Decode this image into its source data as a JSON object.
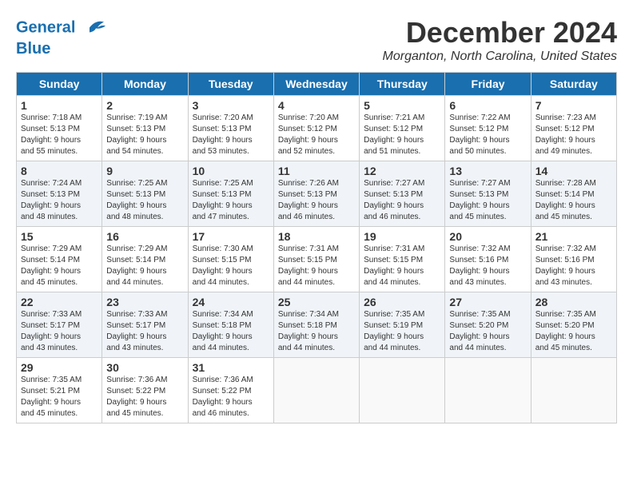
{
  "header": {
    "logo_line1": "General",
    "logo_line2": "Blue",
    "month": "December 2024",
    "location": "Morganton, North Carolina, United States"
  },
  "days_of_week": [
    "Sunday",
    "Monday",
    "Tuesday",
    "Wednesday",
    "Thursday",
    "Friday",
    "Saturday"
  ],
  "weeks": [
    [
      {
        "day": "1",
        "sunrise": "Sunrise: 7:18 AM",
        "sunset": "Sunset: 5:13 PM",
        "daylight": "Daylight: 9 hours and 55 minutes."
      },
      {
        "day": "2",
        "sunrise": "Sunrise: 7:19 AM",
        "sunset": "Sunset: 5:13 PM",
        "daylight": "Daylight: 9 hours and 54 minutes."
      },
      {
        "day": "3",
        "sunrise": "Sunrise: 7:20 AM",
        "sunset": "Sunset: 5:13 PM",
        "daylight": "Daylight: 9 hours and 53 minutes."
      },
      {
        "day": "4",
        "sunrise": "Sunrise: 7:20 AM",
        "sunset": "Sunset: 5:12 PM",
        "daylight": "Daylight: 9 hours and 52 minutes."
      },
      {
        "day": "5",
        "sunrise": "Sunrise: 7:21 AM",
        "sunset": "Sunset: 5:12 PM",
        "daylight": "Daylight: 9 hours and 51 minutes."
      },
      {
        "day": "6",
        "sunrise": "Sunrise: 7:22 AM",
        "sunset": "Sunset: 5:12 PM",
        "daylight": "Daylight: 9 hours and 50 minutes."
      },
      {
        "day": "7",
        "sunrise": "Sunrise: 7:23 AM",
        "sunset": "Sunset: 5:12 PM",
        "daylight": "Daylight: 9 hours and 49 minutes."
      }
    ],
    [
      {
        "day": "8",
        "sunrise": "Sunrise: 7:24 AM",
        "sunset": "Sunset: 5:13 PM",
        "daylight": "Daylight: 9 hours and 48 minutes."
      },
      {
        "day": "9",
        "sunrise": "Sunrise: 7:25 AM",
        "sunset": "Sunset: 5:13 PM",
        "daylight": "Daylight: 9 hours and 48 minutes."
      },
      {
        "day": "10",
        "sunrise": "Sunrise: 7:25 AM",
        "sunset": "Sunset: 5:13 PM",
        "daylight": "Daylight: 9 hours and 47 minutes."
      },
      {
        "day": "11",
        "sunrise": "Sunrise: 7:26 AM",
        "sunset": "Sunset: 5:13 PM",
        "daylight": "Daylight: 9 hours and 46 minutes."
      },
      {
        "day": "12",
        "sunrise": "Sunrise: 7:27 AM",
        "sunset": "Sunset: 5:13 PM",
        "daylight": "Daylight: 9 hours and 46 minutes."
      },
      {
        "day": "13",
        "sunrise": "Sunrise: 7:27 AM",
        "sunset": "Sunset: 5:13 PM",
        "daylight": "Daylight: 9 hours and 45 minutes."
      },
      {
        "day": "14",
        "sunrise": "Sunrise: 7:28 AM",
        "sunset": "Sunset: 5:14 PM",
        "daylight": "Daylight: 9 hours and 45 minutes."
      }
    ],
    [
      {
        "day": "15",
        "sunrise": "Sunrise: 7:29 AM",
        "sunset": "Sunset: 5:14 PM",
        "daylight": "Daylight: 9 hours and 45 minutes."
      },
      {
        "day": "16",
        "sunrise": "Sunrise: 7:29 AM",
        "sunset": "Sunset: 5:14 PM",
        "daylight": "Daylight: 9 hours and 44 minutes."
      },
      {
        "day": "17",
        "sunrise": "Sunrise: 7:30 AM",
        "sunset": "Sunset: 5:15 PM",
        "daylight": "Daylight: 9 hours and 44 minutes."
      },
      {
        "day": "18",
        "sunrise": "Sunrise: 7:31 AM",
        "sunset": "Sunset: 5:15 PM",
        "daylight": "Daylight: 9 hours and 44 minutes."
      },
      {
        "day": "19",
        "sunrise": "Sunrise: 7:31 AM",
        "sunset": "Sunset: 5:15 PM",
        "daylight": "Daylight: 9 hours and 44 minutes."
      },
      {
        "day": "20",
        "sunrise": "Sunrise: 7:32 AM",
        "sunset": "Sunset: 5:16 PM",
        "daylight": "Daylight: 9 hours and 43 minutes."
      },
      {
        "day": "21",
        "sunrise": "Sunrise: 7:32 AM",
        "sunset": "Sunset: 5:16 PM",
        "daylight": "Daylight: 9 hours and 43 minutes."
      }
    ],
    [
      {
        "day": "22",
        "sunrise": "Sunrise: 7:33 AM",
        "sunset": "Sunset: 5:17 PM",
        "daylight": "Daylight: 9 hours and 43 minutes."
      },
      {
        "day": "23",
        "sunrise": "Sunrise: 7:33 AM",
        "sunset": "Sunset: 5:17 PM",
        "daylight": "Daylight: 9 hours and 43 minutes."
      },
      {
        "day": "24",
        "sunrise": "Sunrise: 7:34 AM",
        "sunset": "Sunset: 5:18 PM",
        "daylight": "Daylight: 9 hours and 44 minutes."
      },
      {
        "day": "25",
        "sunrise": "Sunrise: 7:34 AM",
        "sunset": "Sunset: 5:18 PM",
        "daylight": "Daylight: 9 hours and 44 minutes."
      },
      {
        "day": "26",
        "sunrise": "Sunrise: 7:35 AM",
        "sunset": "Sunset: 5:19 PM",
        "daylight": "Daylight: 9 hours and 44 minutes."
      },
      {
        "day": "27",
        "sunrise": "Sunrise: 7:35 AM",
        "sunset": "Sunset: 5:20 PM",
        "daylight": "Daylight: 9 hours and 44 minutes."
      },
      {
        "day": "28",
        "sunrise": "Sunrise: 7:35 AM",
        "sunset": "Sunset: 5:20 PM",
        "daylight": "Daylight: 9 hours and 45 minutes."
      }
    ],
    [
      {
        "day": "29",
        "sunrise": "Sunrise: 7:35 AM",
        "sunset": "Sunset: 5:21 PM",
        "daylight": "Daylight: 9 hours and 45 minutes."
      },
      {
        "day": "30",
        "sunrise": "Sunrise: 7:36 AM",
        "sunset": "Sunset: 5:22 PM",
        "daylight": "Daylight: 9 hours and 45 minutes."
      },
      {
        "day": "31",
        "sunrise": "Sunrise: 7:36 AM",
        "sunset": "Sunset: 5:22 PM",
        "daylight": "Daylight: 9 hours and 46 minutes."
      },
      null,
      null,
      null,
      null
    ]
  ]
}
